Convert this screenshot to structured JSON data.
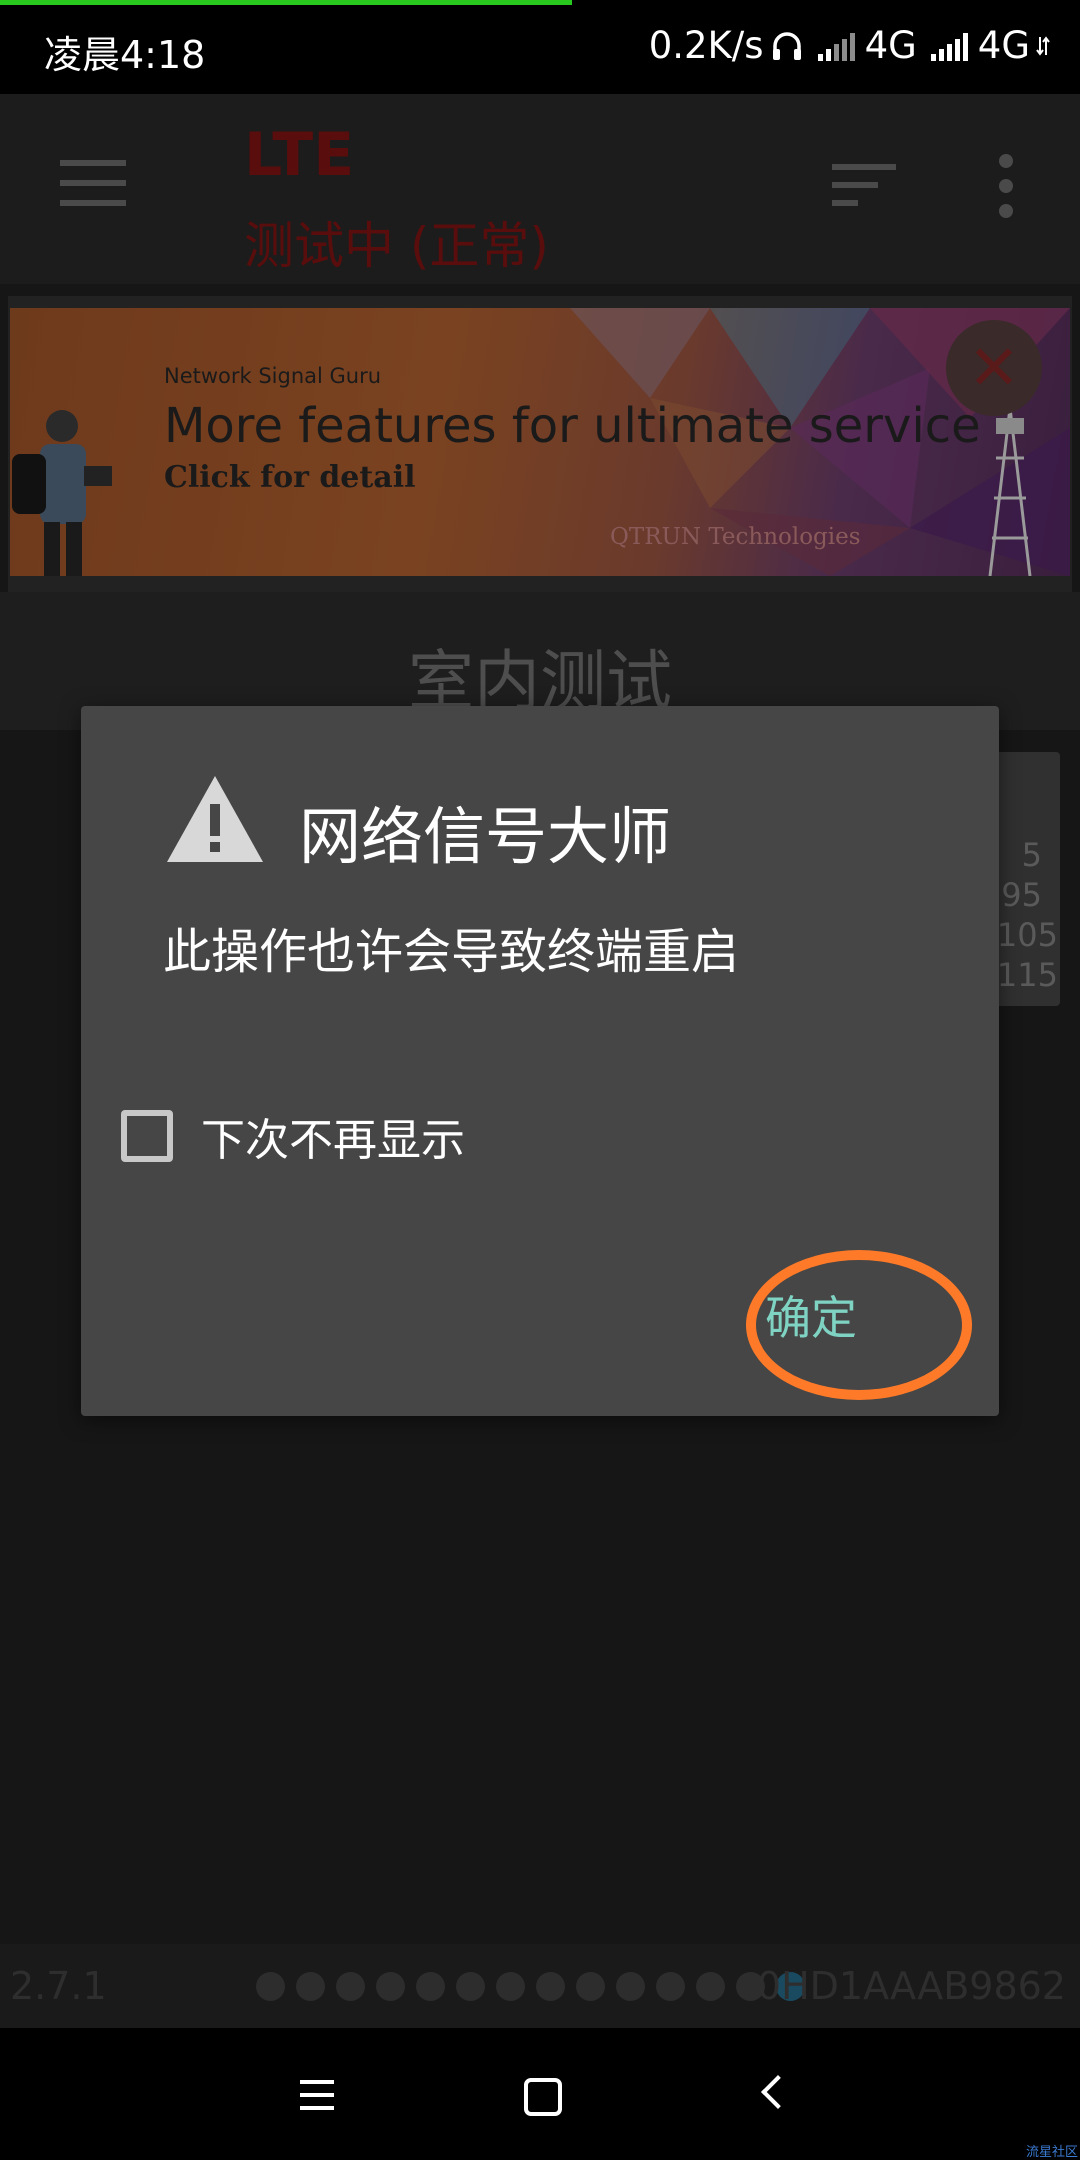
{
  "status_bar": {
    "time": "凌晨4:18",
    "net_speed": "0.2K/s",
    "network_1": "4G",
    "network_2": "4G"
  },
  "app_bar": {
    "title": "LTE",
    "subtitle": "测试中 (正常)"
  },
  "ad": {
    "brand": "Network Signal Guru",
    "headline": "More features for ultimate service",
    "cta": "Click for detail",
    "company": "QTRUN Technologies"
  },
  "page": {
    "heading": "室内测试",
    "side_values": [
      "5",
      "95",
      "105",
      "115"
    ]
  },
  "dialog": {
    "title": "网络信号大师",
    "message": "此操作也许会导致终端重启",
    "checkbox_label": "下次不再显示",
    "checkbox_checked": false,
    "ok_label": "确定"
  },
  "info_bar": {
    "version": "2.7.1",
    "device_id": "0HD1AAAB9862"
  },
  "corner_mark": "流星社区",
  "colors": {
    "accent_button": "#7fd3c3",
    "highlight_ring": "#ff7a28",
    "dialog_bg": "#464646",
    "app_title_dim": "#5a0d0d"
  }
}
